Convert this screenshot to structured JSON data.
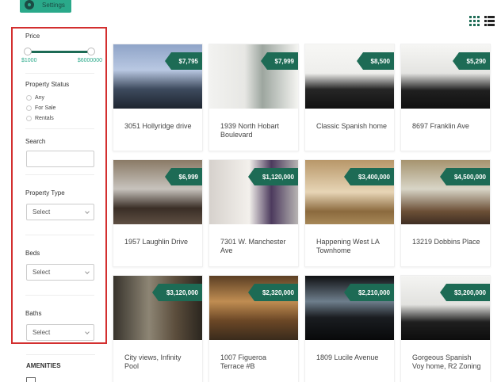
{
  "settings": {
    "label": "Settings"
  },
  "filters": {
    "price_title": "Price",
    "price_min": "$1000",
    "price_max": "$6000000",
    "price_range_fraction": [
      0.0,
      1.0
    ],
    "status_title": "Property Status",
    "status_options": [
      "Any",
      "For Sale",
      "Rentals"
    ],
    "search_title": "Search",
    "search_value": "",
    "property_type_title": "Property Type",
    "property_type_value": "Select",
    "beds_title": "Beds",
    "beds_value": "Select",
    "baths_title": "Baths",
    "baths_value": "Select",
    "amenities_title": "AMENITIES"
  },
  "view": {
    "active": "grid",
    "icons": [
      "grid-view-icon",
      "list-view-icon"
    ]
  },
  "colors": {
    "accent": "#1d6b55",
    "highlight": "#2aa98a",
    "annotation_border": "#d32f2f"
  },
  "listings": [
    {
      "price": "$7,795",
      "title": "3051 Hollyridge drive"
    },
    {
      "price": "$7,999",
      "title": "1939 North Hobart Boulevard"
    },
    {
      "price": "$8,500",
      "title": "Classic Spanish home"
    },
    {
      "price": "$5,290",
      "title": "8697 Franklin Ave"
    },
    {
      "price": "$6,999",
      "title": "1957 Laughlin Drive"
    },
    {
      "price": "$1,120,000",
      "title": "7301 W. Manchester Ave"
    },
    {
      "price": "$3,400,000",
      "title": "Happening West LA Townhome"
    },
    {
      "price": "$4,500,000",
      "title": "13219 Dobbins Place"
    },
    {
      "price": "$3,120,000",
      "title": "City views, Infinity Pool"
    },
    {
      "price": "$2,320,000",
      "title": "1007 Figueroa Terrace #B"
    },
    {
      "price": "$2,210,000",
      "title": "1809 Lucile Avenue"
    },
    {
      "price": "$3,200,000",
      "title": "Gorgeous Spanish Voy home, R2 Zoning"
    }
  ]
}
